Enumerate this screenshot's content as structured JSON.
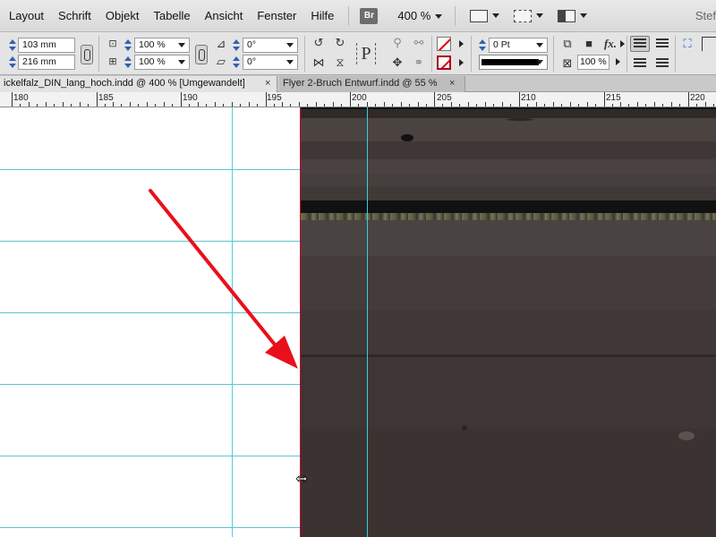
{
  "menu": {
    "items": [
      "Layout",
      "Schrift",
      "Objekt",
      "Tabelle",
      "Ansicht",
      "Fenster",
      "Hilfe"
    ],
    "bridge_label": "Br",
    "zoom": "400 %",
    "user": "Stef"
  },
  "control_panel": {
    "w_value": "103 mm",
    "h_value": "216 mm",
    "scale_x": "100 %",
    "scale_y": "100 %",
    "rotate": "0°",
    "shear": "0°",
    "stroke_weight": "0 Pt",
    "opacity": "100 %",
    "text_frame_symbol": "P",
    "fx_symbol": "fx."
  },
  "tabs": [
    {
      "label": "ickelfalz_DIN_lang_hoch.indd @ 400 % [Umgewandelt]",
      "close": "×",
      "active": true
    },
    {
      "label": "Flyer 2-Bruch Entwurf.indd @ 55 %",
      "close": "×",
      "active": false
    }
  ],
  "ruler": {
    "labels": [
      "180",
      "185",
      "190",
      "195",
      "200",
      "205",
      "210",
      "215",
      "220"
    ]
  },
  "colors": {
    "guide": "#5fc3d0",
    "page_edge": "#d3002b",
    "annotation_arrow": "#e8101a",
    "photo_base": "#3c3534"
  },
  "icons": {
    "arrow": "annotation-arrow-icon",
    "cursor": "resize-cursor-icon"
  }
}
